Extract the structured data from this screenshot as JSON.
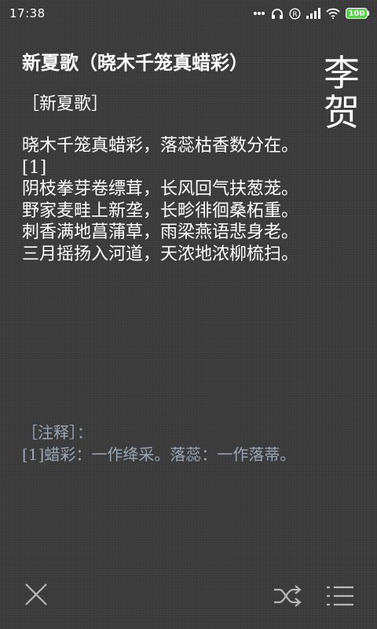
{
  "status_bar": {
    "time": "17:38",
    "battery_level": "100",
    "battery_color": "#58d14b",
    "icons": [
      "dots-icon",
      "headphones-icon",
      "registered-icon",
      "signal-icon",
      "wifi-icon",
      "battery-icon"
    ]
  },
  "author": "李贺",
  "poem": {
    "title": "新夏歌（晓木千笼真蜡彩）",
    "section_label": "［新夏歌］",
    "lines": [
      "晓木千笼真蜡彩，落蕊枯香数分在。[1]",
      "阴枝拳芽卷缥茸，长风回气扶葱茏。",
      "野家麦畦上新垄，长畛徘徊桑柘重。",
      "刺香满地菖蒲草，雨梁燕语悲身老。",
      "三月摇扬入河道，天浓地浓柳梳扫。"
    ]
  },
  "notes": {
    "label": "［注释］：",
    "items": [
      "[1]蜡彩：一作绛采。落蕊：一作落蒂。"
    ],
    "color": "#9aa6b4"
  },
  "toolbar": {
    "icons": [
      "close-icon",
      "shuffle-icon",
      "list-menu-icon"
    ]
  }
}
